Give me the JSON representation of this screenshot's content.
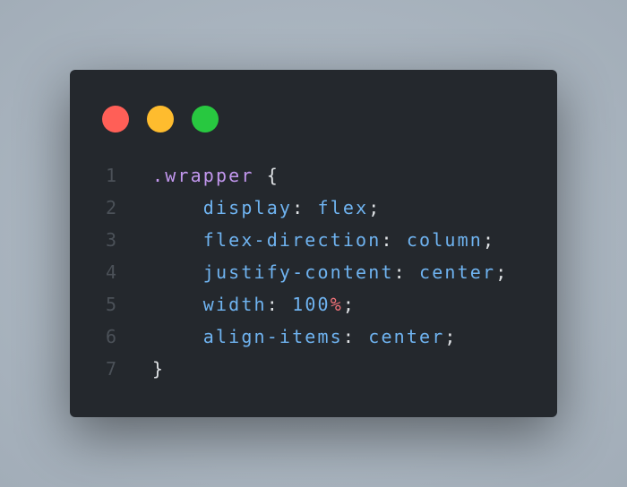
{
  "window": {
    "controls": [
      {
        "name": "close",
        "color": "#ff5f57"
      },
      {
        "name": "minimize",
        "color": "#febc2e"
      },
      {
        "name": "maximize",
        "color": "#28c840"
      }
    ]
  },
  "colors": {
    "background": "#24282d",
    "selector": "#c297ee",
    "property": "#6fb3f0",
    "punctuation": "#dfe2e5",
    "unit": "#f07178",
    "line_number": "#4b5158"
  },
  "code": {
    "lines": [
      {
        "n": "1",
        "tokens": [
          {
            "t": ".wrapper",
            "c": "sel"
          },
          {
            "t": " {",
            "c": "pun"
          }
        ]
      },
      {
        "n": "2",
        "tokens": [
          {
            "t": "    display",
            "c": "prop"
          },
          {
            "t": ": ",
            "c": "pun"
          },
          {
            "t": "flex",
            "c": "val"
          },
          {
            "t": ";",
            "c": "pun"
          }
        ]
      },
      {
        "n": "3",
        "tokens": [
          {
            "t": "    flex-direction",
            "c": "prop"
          },
          {
            "t": ": ",
            "c": "pun"
          },
          {
            "t": "column",
            "c": "val"
          },
          {
            "t": ";",
            "c": "pun"
          }
        ]
      },
      {
        "n": "4",
        "tokens": [
          {
            "t": "    justify-content",
            "c": "prop"
          },
          {
            "t": ": ",
            "c": "pun"
          },
          {
            "t": "center",
            "c": "val"
          },
          {
            "t": ";",
            "c": "pun"
          }
        ]
      },
      {
        "n": "5",
        "tokens": [
          {
            "t": "    width",
            "c": "prop"
          },
          {
            "t": ": ",
            "c": "pun"
          },
          {
            "t": "100",
            "c": "val"
          },
          {
            "t": "%",
            "c": "unit"
          },
          {
            "t": ";",
            "c": "pun"
          }
        ]
      },
      {
        "n": "6",
        "tokens": [
          {
            "t": "    align-items",
            "c": "prop"
          },
          {
            "t": ": ",
            "c": "pun"
          },
          {
            "t": "center",
            "c": "val"
          },
          {
            "t": ";",
            "c": "pun"
          }
        ]
      },
      {
        "n": "7",
        "tokens": [
          {
            "t": "}",
            "c": "pun"
          }
        ]
      }
    ]
  }
}
